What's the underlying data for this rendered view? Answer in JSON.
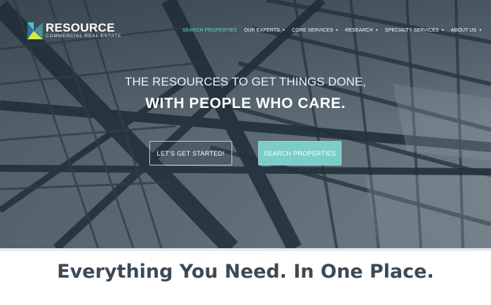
{
  "brand": {
    "name": "RESOURCE",
    "subtitle": "COMMERCIAL REAL ESTATE",
    "colors": {
      "accent": "#6fd4cf",
      "logo_teal": "#4fc7c0",
      "logo_lime": "#d6e84a",
      "logo_blue": "#2e6f9e"
    }
  },
  "nav": {
    "items": [
      {
        "label": "SEARCH PROPERTIES",
        "active": true,
        "has_dropdown": false
      },
      {
        "label": "OUR EXPERTS",
        "has_dropdown": true
      },
      {
        "label": "CORE SERVICES",
        "has_dropdown": true
      },
      {
        "label": "RESEARCH",
        "has_dropdown": true
      },
      {
        "label": "SPECIALTY SERVICES",
        "has_dropdown": true
      },
      {
        "label": "ABOUT US",
        "has_dropdown": true
      }
    ]
  },
  "hero": {
    "line1": "THE RESOURCES TO GET THINGS DONE,",
    "line2": "WITH PEOPLE WHO CARE.",
    "primary_button": "LET'S GET STARTED!",
    "secondary_button": "SEARCH PROPERTIES"
  },
  "section": {
    "heading": "Everything You Need. In One Place."
  }
}
